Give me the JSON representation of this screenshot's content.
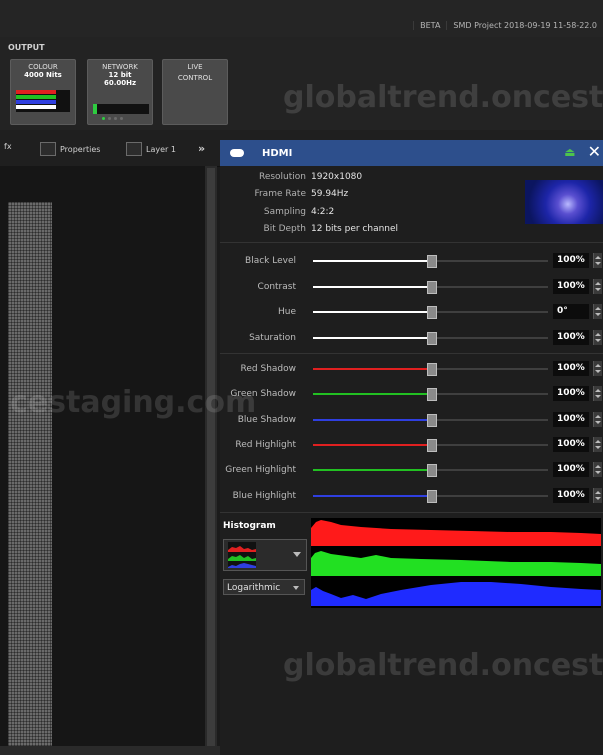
{
  "topbar": {
    "beta": "BETA",
    "project": "SMD Project 2018-09-19 11-58-22.0"
  },
  "output": {
    "label": "OUTPUT",
    "tiles": [
      {
        "title": "COLOUR",
        "line2": "4000 Nits",
        "line3": ""
      },
      {
        "title": "NETWORK",
        "line2": "12 bit",
        "line3": "60.00Hz"
      },
      {
        "title": "LIVE",
        "line2": "CONTROL",
        "line3": ""
      }
    ]
  },
  "toolstrip": {
    "tab_fx": "fx",
    "properties": "Properties",
    "layer": "Layer 1",
    "more": "»"
  },
  "panel": {
    "title": "HDMI",
    "pin_icon": "pin-icon",
    "close_icon": "close-icon",
    "info": {
      "resolution_label": "Resolution",
      "resolution": "1920x1080",
      "framerate_label": "Frame Rate",
      "framerate": "59.94Hz",
      "sampling_label": "Sampling",
      "sampling": "4:2:2",
      "bitdepth_label": "Bit Depth",
      "bitdepth": "12 bits per channel"
    },
    "sliders_a": [
      {
        "label": "Black Level",
        "value": "100%",
        "level": 0.5,
        "color": "#ffffff"
      },
      {
        "label": "Contrast",
        "value": "100%",
        "level": 0.5,
        "color": "#ffffff"
      },
      {
        "label": "Hue",
        "value": "0°",
        "level": 0.5,
        "color": "#ffffff"
      },
      {
        "label": "Saturation",
        "value": "100%",
        "level": 0.5,
        "color": "#ffffff"
      }
    ],
    "sliders_b": [
      {
        "label": "Red Shadow",
        "value": "100%",
        "level": 0.5,
        "color": "#e02020"
      },
      {
        "label": "Green Shadow",
        "value": "100%",
        "level": 0.5,
        "color": "#22c022"
      },
      {
        "label": "Blue Shadow",
        "value": "100%",
        "level": 0.5,
        "color": "#2f3fe0"
      },
      {
        "label": "Red Highlight",
        "value": "100%",
        "level": 0.5,
        "color": "#e02020"
      },
      {
        "label": "Green Highlight",
        "value": "100%",
        "level": 0.5,
        "color": "#22c022"
      },
      {
        "label": "Blue Highlight",
        "value": "100%",
        "level": 0.5,
        "color": "#2f3fe0"
      }
    ],
    "histogram": {
      "label": "Histogram",
      "mode": "Logarithmic"
    }
  },
  "watermarks": [
    "globaltrend.oncest",
    "cestaging.com",
    "globaltrend.oncest"
  ]
}
